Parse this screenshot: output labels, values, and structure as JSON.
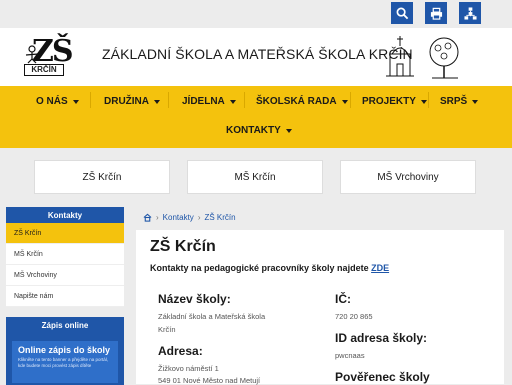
{
  "colors": {
    "accent_blue": "#1f56a8",
    "nav_yellow": "#f4c20d"
  },
  "topbar": {
    "icons": [
      "search-icon",
      "print-icon",
      "sitemap-icon"
    ]
  },
  "header": {
    "logo_text": "ZŠ",
    "logo_subtext": "KRČÍN",
    "title": "ZÁKLADNÍ ŠKOLA A MATEŘSKÁ ŠKOLA KRČÍN"
  },
  "nav": {
    "items": [
      "O NÁS",
      "DRUŽINA",
      "JÍDELNA",
      "ŠKOLSKÁ RADA",
      "PROJEKTY",
      "SRPŠ",
      "KONTAKTY"
    ]
  },
  "cards": [
    "ZŠ Krčín",
    "MŠ Krčín",
    "MŠ Vrchoviny"
  ],
  "sidebar": {
    "heading": "Kontakty",
    "items": [
      "ZŠ Krčín",
      "MŠ Krčín",
      "MŠ Vrchoviny",
      "Napište nám"
    ],
    "online_heading": "Zápis online",
    "online_title": "Online zápis do školy",
    "online_text": "Klikněte na tento banner a přejděte na portál, kde budete moci provést zápis dítěte"
  },
  "breadcrumb": {
    "home_icon": "home-icon",
    "parent": "Kontakty",
    "current": "ZŠ Krčín"
  },
  "content": {
    "title": "ZŠ Krčín",
    "subtitle_text": "Kontakty na pedagogické pracovníky školy najdete",
    "subtitle_link": "ZDE",
    "name_label": "Název školy:",
    "name_line1": "Základní škola a Mateřská škola",
    "name_line2": "Krčín",
    "address_label": "Adresa:",
    "address_line1": "Žižkovo náměstí 1",
    "address_line2": "549 01 Nové Město nad Metují",
    "ic_label": "IČ:",
    "ic_value": "720 20 865",
    "id_label": "ID adresa školy:",
    "id_value": "pwcnaas",
    "poverenec_label": "Pověřenec školy"
  }
}
